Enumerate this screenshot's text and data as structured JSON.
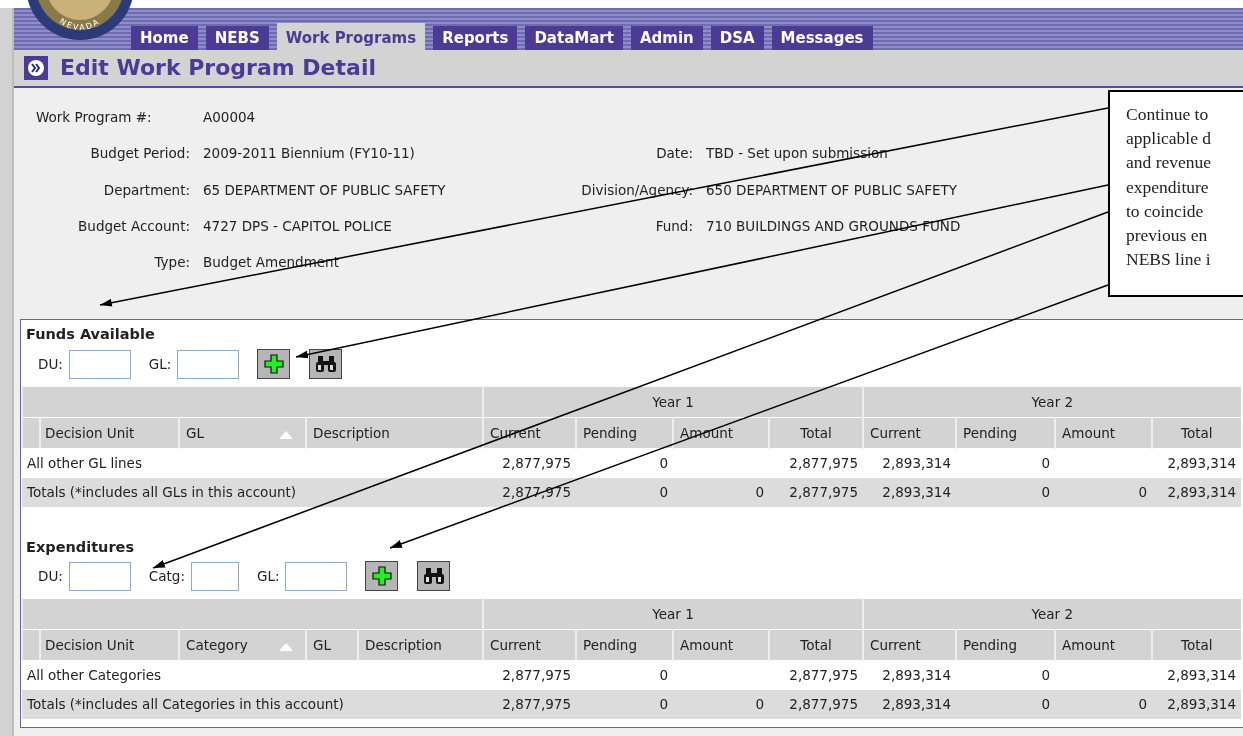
{
  "seal": {
    "text": "NEVADA"
  },
  "tabs": [
    {
      "label": "Home",
      "selected": false
    },
    {
      "label": "NEBS",
      "selected": false
    },
    {
      "label": "Work Programs",
      "selected": true
    },
    {
      "label": "Reports",
      "selected": false
    },
    {
      "label": "DataMart",
      "selected": false
    },
    {
      "label": "Admin",
      "selected": false
    },
    {
      "label": "DSA",
      "selected": false
    },
    {
      "label": "Messages",
      "selected": false
    }
  ],
  "page_title": "Edit Work Program Detail",
  "details": [
    [
      {
        "label": "Work Program #:",
        "value": "A00004"
      }
    ],
    [
      {
        "label": "Budget Period:",
        "value": "2009-2011 Biennium (FY10-11)"
      },
      {
        "label": "Date:",
        "value": "TBD - Set upon submission"
      }
    ],
    [
      {
        "label": "Department:",
        "value": "65 DEPARTMENT OF PUBLIC SAFETY"
      },
      {
        "label": "Division/Agency:",
        "value": "650 DEPARTMENT OF PUBLIC SAFETY"
      }
    ],
    [
      {
        "label": "Budget Account:",
        "value": "4727 DPS - CAPITOL POLICE"
      },
      {
        "label": "Fund:",
        "value": "710 BUILDINGS AND GROUNDS FUND"
      }
    ],
    [
      {
        "label": "Type:",
        "value": "Budget Amendment"
      }
    ]
  ],
  "sections": [
    {
      "title": "Funds Available",
      "filters": [
        {
          "label": "DU:"
        },
        {
          "label": "GL:"
        }
      ],
      "table": {
        "groups": [
          "Year 1",
          "Year 2"
        ],
        "columns": [
          {
            "label": "Decision Unit",
            "sorted": false
          },
          {
            "label": "GL",
            "sorted": true
          },
          {
            "label": "Description",
            "sorted": false
          },
          {
            "label": "Current",
            "sorted": false
          },
          {
            "label": "Pending",
            "sorted": false
          },
          {
            "label": "Amount",
            "sorted": false
          },
          {
            "label": "Total",
            "sorted": false
          },
          {
            "label": "Current",
            "sorted": false
          },
          {
            "label": "Pending",
            "sorted": false
          },
          {
            "label": "Amount",
            "sorted": false
          },
          {
            "label": "Total",
            "sorted": false
          }
        ],
        "rows": [
          {
            "kind": "line",
            "cells": [
              "All other GL lines",
              "",
              "",
              "2,877,975",
              "0",
              "",
              "2,877,975",
              "2,893,314",
              "0",
              "",
              "2,893,314"
            ]
          },
          {
            "kind": "totals",
            "cells": [
              {
                "text": "Totals (*includes all GLs in this account)",
                "colspan": 2
              },
              "",
              "2,877,975",
              "0",
              "0",
              "2,877,975",
              "2,893,314",
              "0",
              "0",
              "2,893,314"
            ]
          }
        ]
      }
    },
    {
      "title": "Expenditures",
      "filters": [
        {
          "label": "DU:"
        },
        {
          "label": "Catg:"
        },
        {
          "label": "GL:"
        }
      ],
      "table": {
        "groups": [
          "Year 1",
          "Year 2"
        ],
        "columns": [
          {
            "label": "Decision Unit",
            "sorted": false
          },
          {
            "label": "Category",
            "sorted": true
          },
          {
            "label": "GL",
            "sorted": false
          },
          {
            "label": "Description",
            "sorted": false
          },
          {
            "label": "Current",
            "sorted": false
          },
          {
            "label": "Pending",
            "sorted": false
          },
          {
            "label": "Amount",
            "sorted": false
          },
          {
            "label": "Total",
            "sorted": false
          },
          {
            "label": "Current",
            "sorted": false
          },
          {
            "label": "Pending",
            "sorted": false
          },
          {
            "label": "Amount",
            "sorted": false
          },
          {
            "label": "Total",
            "sorted": false
          }
        ],
        "rows": [
          {
            "kind": "line",
            "cells": [
              "All other Categories",
              "",
              "",
              "",
              "2,877,975",
              "0",
              "",
              "2,877,975",
              "2,893,314",
              "0",
              "",
              "2,893,314"
            ]
          },
          {
            "kind": "totals",
            "cells": [
              {
                "text": "Totals (*includes all Categories in this account)",
                "colspan": 3
              },
              "",
              "2,877,975",
              "0",
              "0",
              "2,877,975",
              "2,893,314",
              "0",
              "0",
              "2,893,314"
            ]
          }
        ]
      }
    }
  ],
  "callout": {
    "lines": [
      "Continue to",
      "applicable d",
      "and revenue",
      "expenditure",
      "to coincide",
      "previous en",
      "NEBS line i"
    ]
  }
}
